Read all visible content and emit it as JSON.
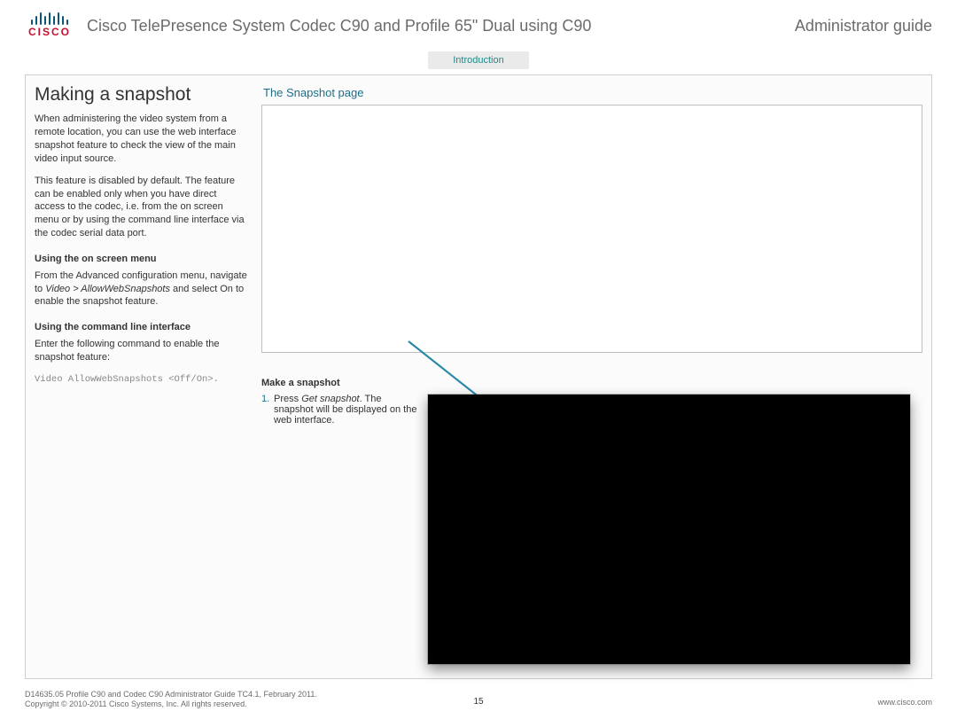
{
  "header": {
    "logo_text": "CISCO",
    "title": "Cisco TelePresence System Codec C90 and Profile 65\" Dual using C90",
    "right": "Administrator guide"
  },
  "subnav": {
    "tab": "Introduction"
  },
  "left": {
    "heading": "Making a snapshot",
    "p1": "When administering the video system from a remote location, you can use the web interface snapshot feature to check the view of the main video input source.",
    "p2": "This feature is disabled by default. The feature can be enabled only when you have direct access to the codec, i.e. from the on screen menu or by using the command line interface via the codec serial data port.",
    "sub1": "Using the on screen menu",
    "p3a": "From the Advanced configuration menu, navigate to ",
    "p3b": "Video > AllowWebSnapshots",
    "p3c": " and select On to enable the snapshot feature.",
    "sub2": "Using the command line interface",
    "p4": "Enter the following command to enable the snapshot feature:",
    "cmd": "Video AllowWebSnapshots <Off/On>."
  },
  "right": {
    "panel_title": "The Snapshot page",
    "step_title": "Make a snapshot",
    "step_num": "1.",
    "step_a": "Press ",
    "step_b": "Get snapshot",
    "step_c": ". The snapshot will be displayed on the web interface."
  },
  "footer": {
    "line1": "D14635.05 Profile C90 and Codec C90 Administrator Guide TC4.1, February 2011.",
    "line2": "Copyright © 2010-2011 Cisco Systems, Inc. All rights reserved.",
    "page": "15",
    "url": "www.cisco.com"
  }
}
